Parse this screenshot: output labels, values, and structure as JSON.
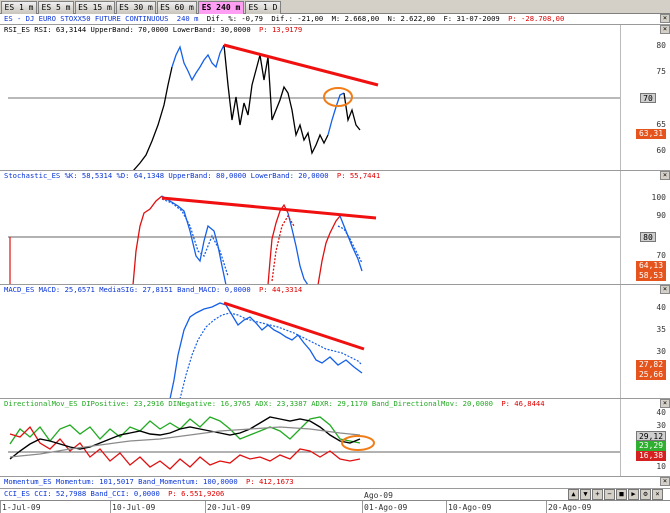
{
  "tabs": [
    {
      "label": "ES 1 m",
      "active": false
    },
    {
      "label": "ES 5 m",
      "active": false
    },
    {
      "label": "ES 15 m",
      "active": false
    },
    {
      "label": "ES 30 m",
      "active": false
    },
    {
      "label": "ES 60 m",
      "active": false
    },
    {
      "label": "ES 240 m",
      "active": true
    },
    {
      "label": "ES 1 D",
      "active": false
    }
  ],
  "price_header": {
    "name": "ES - DJ EURO STOXX50 FUTURE CONTINUOUS",
    "tf": "240 m",
    "diff": "Dif. %: -0,79",
    "dif": "Dif.: -21,00",
    "m": "M: 2.668,00",
    "n": "N: 2.622,00",
    "f": "F: 31-07-2009",
    "p": "P: -28.708,00"
  },
  "panes": {
    "rsi": {
      "header_a": "RSI_ES RSI: 63,3144 UpperBand: 70,0000 LowerBand: 30,0000",
      "header_p": "P: 13,9179",
      "ticks": [
        "80",
        "75",
        "70",
        "65",
        "60"
      ],
      "tag_value": "63,31",
      "tag_level": "70"
    },
    "stoch": {
      "header_a": "Stochastic_ES %K: 58,5314 %D: 64,1348 UpperBand: 80,0000 LowerBand: 20,0000",
      "header_p": "P: 55,7441",
      "ticks": [
        "100",
        "90",
        "80",
        "70"
      ],
      "tag_level": "80",
      "tag_k": "64,13",
      "tag_d": "58,53"
    },
    "macd": {
      "header_a": "MACD_ES MACD: 25,6571 MediaSIG: 27,8151 Band_MACD: 0,0000",
      "header_p": "P: 44,3314",
      "ticks": [
        "40",
        "35",
        "30",
        "25"
      ],
      "tag_sig": "27,82",
      "tag_macd": "25,66"
    },
    "dmi": {
      "header_a": "DirectionalMov_ES DIPositive: 23,2916 DINegative: 16,3765 ADX: 23,3387 ADXR: 29,1170 Band_DirectionalMov: 20,0000",
      "header_p": "P: 46,8444",
      "ticks": [
        "40",
        "30",
        "20",
        "10"
      ],
      "tag_adxr": "29,12",
      "tag_pos": "23,29",
      "tag_neg": "16,38"
    },
    "momentum": {
      "header_a": "Momentum_ES Momentum: 101,5017 Band_Momentum: 100,0000",
      "header_p": "P: 412,1673"
    },
    "cci": {
      "header_a": "CCI_ES CCI: 52,7988 Band_CCI: 0,0000",
      "header_p": "P: 6.551,9206"
    }
  },
  "xaxis": {
    "labels": [
      "1-Jul-09",
      "10-Jul-09",
      "20-Jul-09",
      "Ago-09",
      "01-Ago-09",
      "10-Ago-09",
      "20-Ago-09"
    ]
  },
  "colors": {
    "black_line": "#000000",
    "blue_line": "#1560e8",
    "red_line": "#e01010",
    "green_line": "#22aa22",
    "gray_line": "#7a7a7a",
    "trendline": "#f01010",
    "highlight": "#f07d18"
  },
  "icons": [
    "chevron-up-icon",
    "chevron-down-icon",
    "zoom-in-icon",
    "zoom-out-icon",
    "save-icon",
    "play-icon",
    "settings-icon",
    "close-icon"
  ]
}
